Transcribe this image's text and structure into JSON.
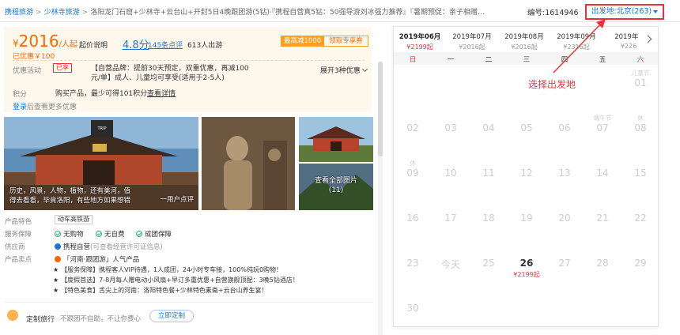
{
  "breadcrumb": {
    "items": [
      "携程旅游",
      "少林寺旅游"
    ],
    "separator": ">",
    "product_title": "洛阳龙门石窟+少林寺+云台山+开封5日4晚跟团游(5钻)·『携程自营真5钻：50强导游刘冰强力推荐』『暑期预促：亲子相赠…"
  },
  "product_no": "编号:1614946",
  "departure": {
    "label": "出发地:北京(263)",
    "icon": "caret-down-icon"
  },
  "price_panel": {
    "currency": "¥",
    "price": "2016",
    "unit": "/人起",
    "from_note": "起价说明",
    "saved": "已优惠￥100",
    "rating": "4.8分",
    "reviews": "145条点评",
    "departed": "613人出游",
    "max_discount": "最高减1000",
    "coupon_button": "领取专享券",
    "promo_label": "优惠活动",
    "promo_tag": "已享",
    "promo_text": "【自营品牌：提前30天预定，双重优惠，再减100元/单】成人、儿童均可享受(适用于2-5人)",
    "more_promos": "展开3种优惠",
    "points_label": "积分",
    "points_text": "购买产品，最少可得101积分",
    "points_link": "查看详情",
    "login_link": "登录",
    "login_note": "后查看更多优惠"
  },
  "gallery": {
    "caption": "历史，风景，人物，植物，还有美河，值得去看看，毕竟洛阳，有些地方如果想错",
    "user_label": "一用户点评",
    "all_photos": "查看全部图片",
    "photo_count": "(11)"
  },
  "features": {
    "special_label": "产品特色",
    "special_tag": "动车高铁游",
    "guarantee_label": "服务保障",
    "guarantees": [
      "无购物",
      "无自费",
      "成团保障"
    ],
    "supplier_label": "供应商",
    "supplier_name": "携程自营",
    "supplier_note": "(可查看经营许可证信息)",
    "highlight_label": "产品卖点",
    "highlight_title": "「河南·跟团游」人气产品",
    "highlights": [
      "【服务保障】携程客人VIP待遇，1人成团，24小时专车接，100%纯玩0购物！",
      "【度假首选】7-8月每人赠电动小风扇+早订多重优惠+自营旗舰顶配：3晚5钻酒店！",
      "【特色美食】舌尖上的河南：洛阳特色餐+少林特色素斋+云台山养生宴！"
    ]
  },
  "custom_trip": {
    "title": "定制旅行",
    "desc": "不跟团不自助，不让你费心",
    "button": "立即定制"
  },
  "calendar": {
    "months": [
      {
        "name": "2019年06月",
        "price": "¥2199起",
        "active": true
      },
      {
        "name": "2019年07月",
        "price": "¥2016起",
        "active": false
      },
      {
        "name": "2019年08月",
        "price": "¥2016起",
        "active": false
      },
      {
        "name": "2019年09月",
        "price": "¥2316起",
        "active": false
      },
      {
        "name": "2019年1",
        "price": "¥226",
        "active": false
      }
    ],
    "weekdays": [
      "日",
      "一",
      "二",
      "三",
      "四",
      "五",
      "六"
    ],
    "weeks": [
      [
        {
          "d": ""
        },
        {
          "d": ""
        },
        {
          "d": ""
        },
        {
          "d": ""
        },
        {
          "d": ""
        },
        {
          "d": ""
        },
        {
          "d": "01",
          "f": "儿童节"
        }
      ],
      [
        {
          "d": "02"
        },
        {
          "d": "03"
        },
        {
          "d": "04"
        },
        {
          "d": "05"
        },
        {
          "d": "06"
        },
        {
          "d": "07",
          "f": "端午节"
        },
        {
          "d": "08",
          "f": "休"
        }
      ],
      [
        {
          "d": "09",
          "f": "休"
        },
        {
          "d": "10"
        },
        {
          "d": "11"
        },
        {
          "d": "12"
        },
        {
          "d": "13"
        },
        {
          "d": "14"
        },
        {
          "d": "15"
        }
      ],
      [
        {
          "d": "16"
        },
        {
          "d": "17"
        },
        {
          "d": "18"
        },
        {
          "d": "19"
        },
        {
          "d": "20"
        },
        {
          "d": "21"
        },
        {
          "d": "22"
        }
      ],
      [
        {
          "d": "23"
        },
        {
          "d": "今天"
        },
        {
          "d": "25"
        },
        {
          "d": "26",
          "p": "¥2199起",
          "avail": true
        },
        {
          "d": "27"
        },
        {
          "d": "28"
        },
        {
          "d": "29"
        }
      ],
      [
        {
          "d": "30"
        },
        {
          "d": ""
        },
        {
          "d": ""
        },
        {
          "d": ""
        },
        {
          "d": ""
        },
        {
          "d": ""
        },
        {
          "d": ""
        }
      ]
    ]
  },
  "annotation": "选择出发地",
  "colors": {
    "accent": "#e8333a",
    "link": "#1a76d2",
    "price": "#ff6600",
    "panel_bg": "#fff8ec"
  }
}
